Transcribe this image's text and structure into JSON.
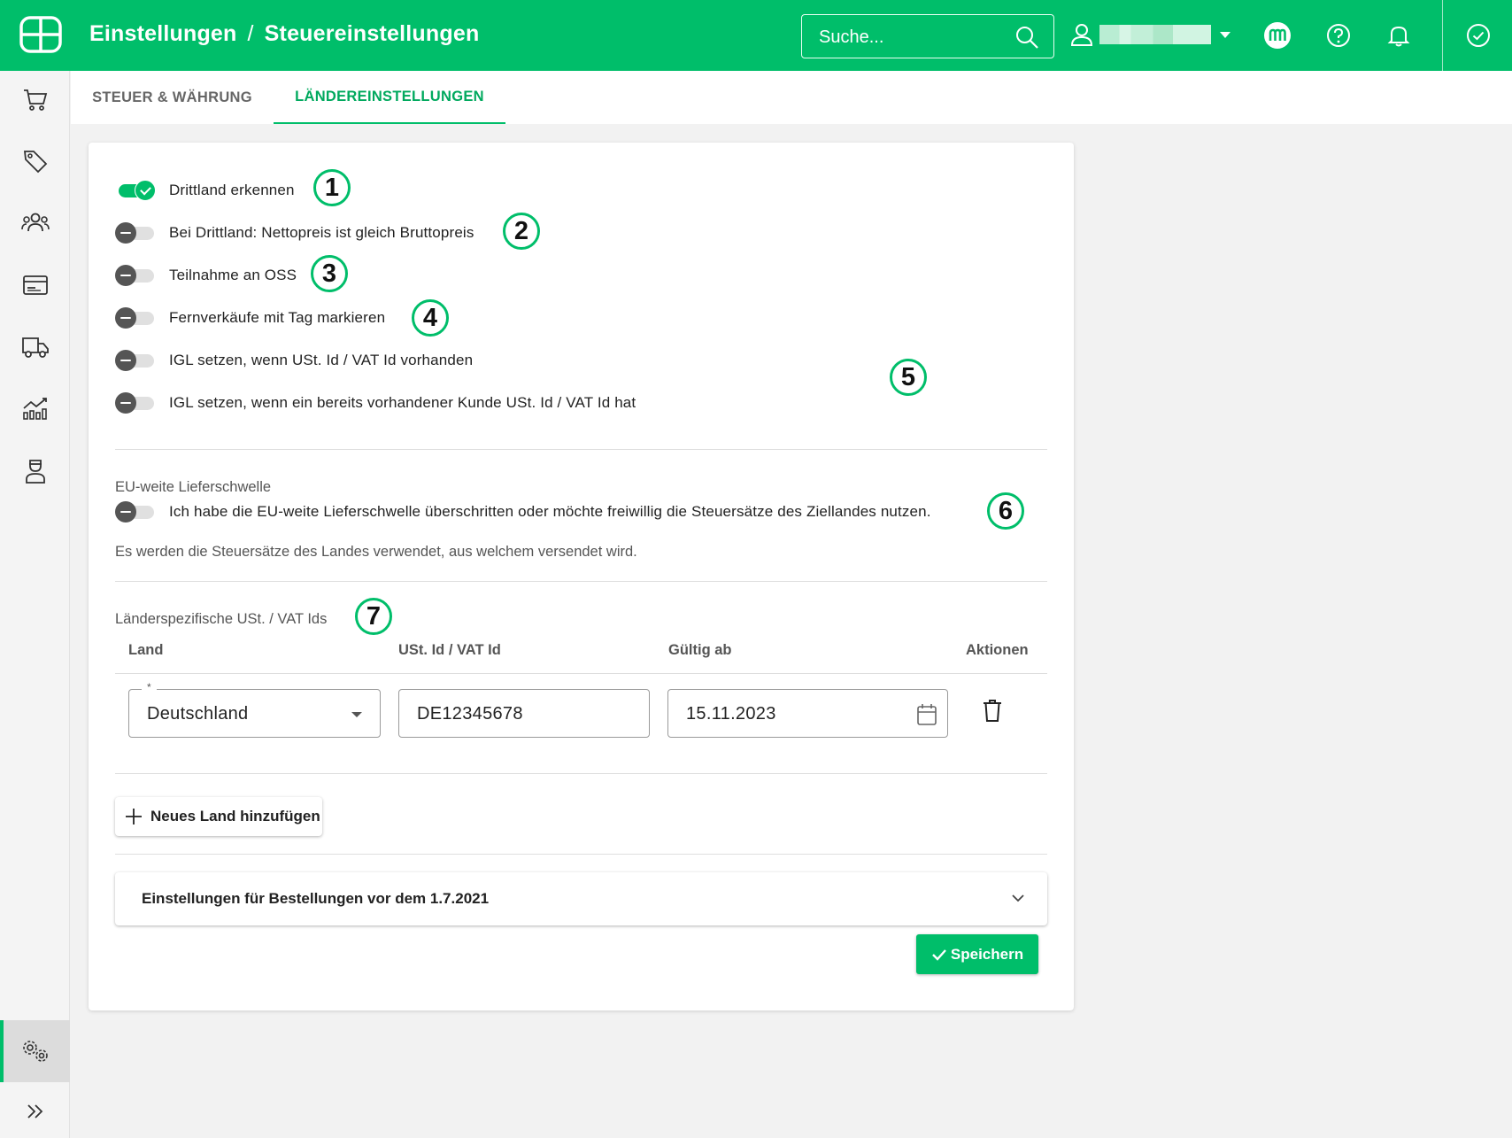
{
  "header": {
    "breadcrumb_parent": "Einstellungen",
    "breadcrumb_separator": "/",
    "breadcrumb_current": "Steuereinstellungen",
    "search_placeholder": "Suche...",
    "brand_color": "#00be6a"
  },
  "header_icons": [
    "logo-icon",
    "search-icon",
    "user-icon",
    "chevron-down-icon",
    "marketplace-icon",
    "help-icon",
    "bell-icon",
    "check-circle-icon"
  ],
  "sidebar": {
    "items": [
      "cart-icon",
      "tag-icon",
      "customers-icon",
      "payment-icon",
      "shipping-icon",
      "analytics-icon",
      "agent-icon",
      "settings-icon",
      "expand-icon"
    ],
    "active": "settings-icon"
  },
  "tabs": [
    {
      "label": "STEUER & WÄHRUNG",
      "active": false
    },
    {
      "label": "LÄNDEREINSTELLUNGEN",
      "active": true
    }
  ],
  "toggles": [
    {
      "label": "Drittland erkennen",
      "on": true
    },
    {
      "label": "Bei Drittland: Nettopreis ist gleich Bruttopreis",
      "on": false
    },
    {
      "label": "Teilnahme an OSS",
      "on": false
    },
    {
      "label": "Fernverkäufe mit Tag markieren",
      "on": false
    },
    {
      "label": "IGL setzen, wenn USt. Id / VAT Id vorhanden",
      "on": false
    },
    {
      "label": "IGL setzen, wenn ein bereits vorhandener Kunde USt. Id / VAT Id hat",
      "on": false
    }
  ],
  "badges": [
    "1",
    "2",
    "3",
    "4",
    "5",
    "6",
    "7"
  ],
  "eu_threshold": {
    "title": "EU-weite Lieferschwelle",
    "toggle_label": "Ich habe die EU-weite Lieferschwelle überschritten oder möchte freiwillig die Steuersätze des Ziellandes nutzen.",
    "toggle_on": false,
    "info": "Es werden die Steuersätze des Landes verwendet, aus welchem versendet wird."
  },
  "vat_ids": {
    "title": "Länderspezifische USt. / VAT Ids",
    "columns": [
      "Land",
      "USt. Id / VAT Id",
      "Gültig ab",
      "Aktionen"
    ],
    "rows": [
      {
        "country": "Deutschland",
        "required_mark": "*",
        "vat_id": "DE12345678",
        "valid_from": "15.11.2023"
      }
    ],
    "add_button": "Neues Land hinzufügen"
  },
  "legacy": {
    "accordion_label": "Einstellungen für Bestellungen vor dem 1.7.2021"
  },
  "save_button": "Speichern"
}
